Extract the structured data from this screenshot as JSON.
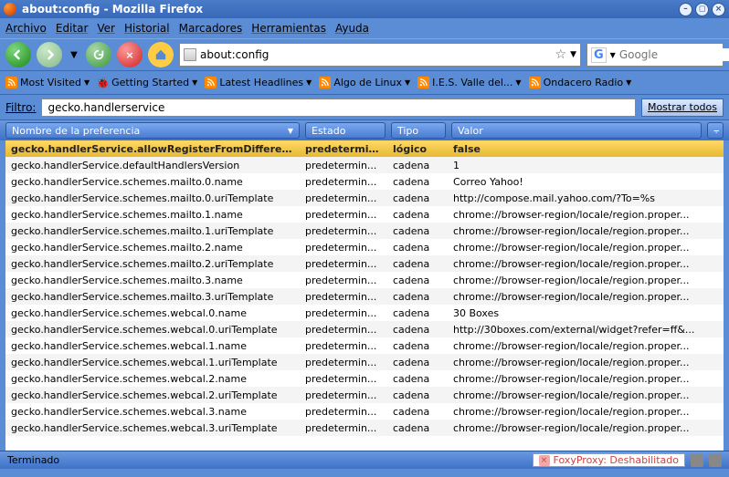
{
  "window": {
    "title": "about:config - Mozilla Firefox"
  },
  "menu": [
    "Archivo",
    "Editar",
    "Ver",
    "Historial",
    "Marcadores",
    "Herramientas",
    "Ayuda"
  ],
  "url": "about:config",
  "search_placeholder": "Google",
  "bookmarks": [
    {
      "label": "Most Visited",
      "icon": "rss"
    },
    {
      "label": "Getting Started",
      "icon": "bug"
    },
    {
      "label": "Latest Headlines",
      "icon": "rss"
    },
    {
      "label": "Algo de Linux",
      "icon": "rss"
    },
    {
      "label": "I.E.S. Valle del...",
      "icon": "rss"
    },
    {
      "label": "Ondacero Radio",
      "icon": "rss"
    }
  ],
  "filter": {
    "label": "Filtro:",
    "value": "gecko.handlerservice",
    "showall": "Mostrar todos"
  },
  "columns": {
    "name": "Nombre de la preferencia",
    "state": "Estado",
    "type": "Tipo",
    "value": "Valor"
  },
  "rows": [
    {
      "name": "gecko.handlerService.allowRegisterFromDifferentHost",
      "state": "predetermin...",
      "type": "lógico",
      "value": "false",
      "sel": true
    },
    {
      "name": "gecko.handlerService.defaultHandlersVersion",
      "state": "predetermin...",
      "type": "cadena",
      "value": "1"
    },
    {
      "name": "gecko.handlerService.schemes.mailto.0.name",
      "state": "predetermin...",
      "type": "cadena",
      "value": "Correo Yahoo!"
    },
    {
      "name": "gecko.handlerService.schemes.mailto.0.uriTemplate",
      "state": "predetermin...",
      "type": "cadena",
      "value": "http://compose.mail.yahoo.com/?To=%s"
    },
    {
      "name": "gecko.handlerService.schemes.mailto.1.name",
      "state": "predetermin...",
      "type": "cadena",
      "value": "chrome://browser-region/locale/region.proper..."
    },
    {
      "name": "gecko.handlerService.schemes.mailto.1.uriTemplate",
      "state": "predetermin...",
      "type": "cadena",
      "value": "chrome://browser-region/locale/region.proper..."
    },
    {
      "name": "gecko.handlerService.schemes.mailto.2.name",
      "state": "predetermin...",
      "type": "cadena",
      "value": "chrome://browser-region/locale/region.proper..."
    },
    {
      "name": "gecko.handlerService.schemes.mailto.2.uriTemplate",
      "state": "predetermin...",
      "type": "cadena",
      "value": "chrome://browser-region/locale/region.proper..."
    },
    {
      "name": "gecko.handlerService.schemes.mailto.3.name",
      "state": "predetermin...",
      "type": "cadena",
      "value": "chrome://browser-region/locale/region.proper..."
    },
    {
      "name": "gecko.handlerService.schemes.mailto.3.uriTemplate",
      "state": "predetermin...",
      "type": "cadena",
      "value": "chrome://browser-region/locale/region.proper..."
    },
    {
      "name": "gecko.handlerService.schemes.webcal.0.name",
      "state": "predetermin...",
      "type": "cadena",
      "value": "30 Boxes"
    },
    {
      "name": "gecko.handlerService.schemes.webcal.0.uriTemplate",
      "state": "predetermin...",
      "type": "cadena",
      "value": "http://30boxes.com/external/widget?refer=ff&..."
    },
    {
      "name": "gecko.handlerService.schemes.webcal.1.name",
      "state": "predetermin...",
      "type": "cadena",
      "value": "chrome://browser-region/locale/region.proper..."
    },
    {
      "name": "gecko.handlerService.schemes.webcal.1.uriTemplate",
      "state": "predetermin...",
      "type": "cadena",
      "value": "chrome://browser-region/locale/region.proper..."
    },
    {
      "name": "gecko.handlerService.schemes.webcal.2.name",
      "state": "predetermin...",
      "type": "cadena",
      "value": "chrome://browser-region/locale/region.proper..."
    },
    {
      "name": "gecko.handlerService.schemes.webcal.2.uriTemplate",
      "state": "predetermin...",
      "type": "cadena",
      "value": "chrome://browser-region/locale/region.proper..."
    },
    {
      "name": "gecko.handlerService.schemes.webcal.3.name",
      "state": "predetermin...",
      "type": "cadena",
      "value": "chrome://browser-region/locale/region.proper..."
    },
    {
      "name": "gecko.handlerService.schemes.webcal.3.uriTemplate",
      "state": "predetermin...",
      "type": "cadena",
      "value": "chrome://browser-region/locale/region.proper..."
    }
  ],
  "status": {
    "left": "Terminado",
    "foxy": "FoxyProxy: Deshabilitado"
  }
}
